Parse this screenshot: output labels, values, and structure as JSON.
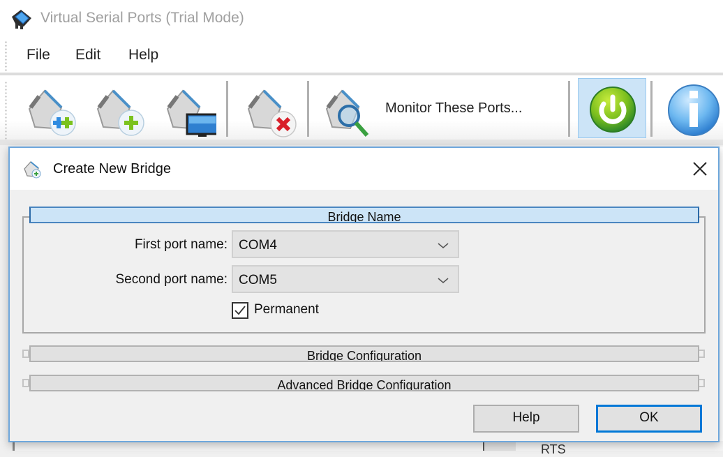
{
  "app": {
    "title": "Virtual Serial Ports (Trial Mode)",
    "icon": "serial-port-icon"
  },
  "menubar": {
    "items": [
      {
        "label": "File"
      },
      {
        "label": "Edit"
      },
      {
        "label": "Help"
      }
    ]
  },
  "toolbar": {
    "buttons": [
      {
        "icon": "create-pair-icon",
        "label": ""
      },
      {
        "icon": "create-port-icon",
        "label": ""
      },
      {
        "icon": "local-port-icon",
        "label": ""
      },
      {
        "icon": "delete-port-icon",
        "label": ""
      },
      {
        "icon": "monitor-icon",
        "label": "Monitor These Ports..."
      },
      {
        "icon": "power-icon",
        "label": "",
        "active": true
      },
      {
        "icon": "info-icon",
        "label": ""
      }
    ]
  },
  "background": {
    "partial_text": "RTS"
  },
  "dialog": {
    "title": "Create New Bridge",
    "icon": "bridge-icon",
    "close_icon": "close-icon",
    "sections": [
      {
        "label": "Bridge Name",
        "expanded": true
      },
      {
        "label": "Bridge Configuration",
        "expanded": false
      },
      {
        "label": "Advanced Bridge Configuration",
        "expanded": false
      }
    ],
    "fields": {
      "first_port": {
        "label": "First port name:",
        "value": "COM4"
      },
      "second_port": {
        "label": "Second port name:",
        "value": "COM5"
      },
      "permanent": {
        "label": "Permanent",
        "checked": true
      }
    },
    "buttons": {
      "help": "Help",
      "ok": "OK"
    }
  },
  "colors": {
    "accent": "#0078d7",
    "section_expanded_bg": "#cce4f7",
    "section_expanded_border": "#2b6aa8",
    "dialog_border": "#6ea7dc",
    "app_title": "#a0a0a0"
  }
}
